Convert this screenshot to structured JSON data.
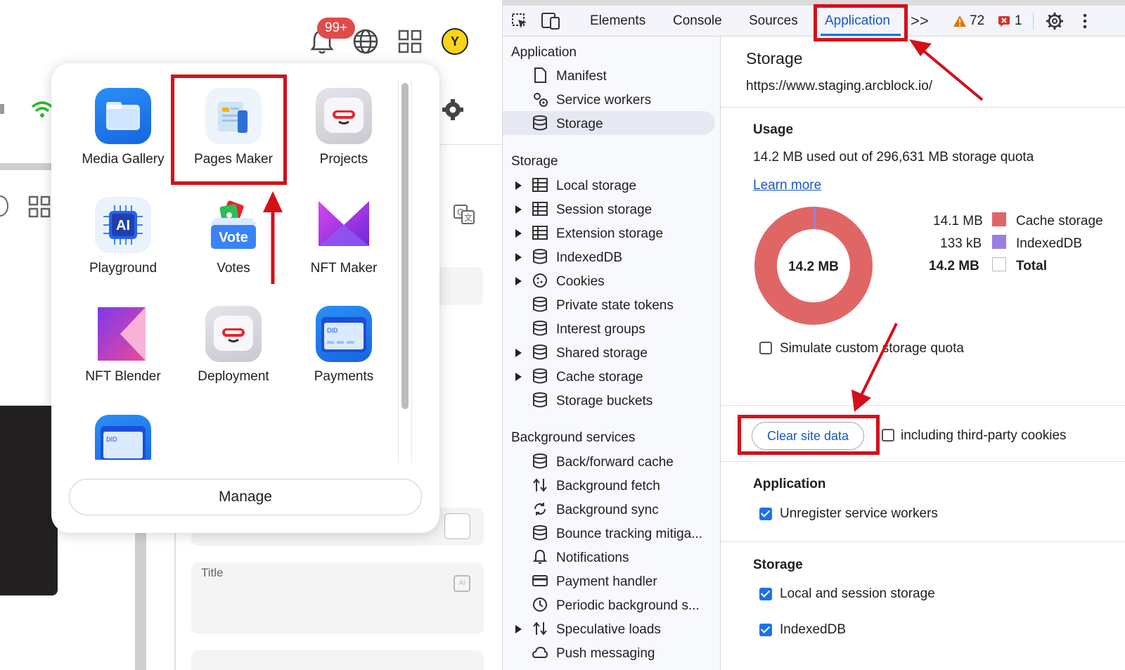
{
  "left_app": {
    "notification_badge": "99+",
    "avatar_letter": "Y",
    "apps": [
      {
        "label": "Media Gallery"
      },
      {
        "label": "Pages Maker"
      },
      {
        "label": "Projects"
      },
      {
        "label": "Playground"
      },
      {
        "label": "Votes"
      },
      {
        "label": "NFT Maker"
      },
      {
        "label": "NFT Blender"
      },
      {
        "label": "Deployment"
      },
      {
        "label": "Payments"
      }
    ],
    "vote_icon_text": "Vote",
    "ai_icon_text": "AI",
    "did_icon_text": "DID",
    "manage_label": "Manage",
    "title_field_label": "Title"
  },
  "devtools": {
    "tabs": [
      "Elements",
      "Console",
      "Sources",
      "Application"
    ],
    "active_tab": "Application",
    "more_tabs": ">>",
    "warnings_count": "72",
    "errors_count": "1",
    "sidebar": {
      "application_header": "Application",
      "application_items": [
        "Manifest",
        "Service workers",
        "Storage"
      ],
      "storage_header": "Storage",
      "storage_items": [
        "Local storage",
        "Session storage",
        "Extension storage",
        "IndexedDB",
        "Cookies",
        "Private state tokens",
        "Interest groups",
        "Shared storage",
        "Cache storage",
        "Storage buckets"
      ],
      "background_header": "Background services",
      "background_items": [
        "Back/forward cache",
        "Background fetch",
        "Background sync",
        "Bounce tracking mitiga...",
        "Notifications",
        "Payment handler",
        "Periodic background s...",
        "Speculative loads",
        "Push messaging"
      ]
    },
    "main": {
      "title": "Storage",
      "origin": "https://www.staging.arcblock.io/",
      "usage_header": "Usage",
      "usage_text": "14.2 MB used out of 296,631 MB storage quota",
      "learn_more": "Learn more",
      "donut_center": "14.2 MB",
      "legend": [
        {
          "value": "14.1 MB",
          "label": "Cache storage",
          "color": "#e06666"
        },
        {
          "value": "133 kB",
          "label": "IndexedDB",
          "color": "#9b7ee0"
        },
        {
          "value": "14.2 MB",
          "label": "Total",
          "color": "#ffffff"
        }
      ],
      "simulate_label": "Simulate custom storage quota",
      "clear_button": "Clear site data",
      "third_party_label": "including third-party cookies",
      "application_header": "Application",
      "unregister_label": "Unregister service workers",
      "storage_header": "Storage",
      "local_session_label": "Local and session storage",
      "indexeddb_label": "IndexedDB"
    }
  },
  "colors": {
    "annotation_red": "#d3101a",
    "accent_blue": "#1a73e8",
    "cache_red": "#e06666",
    "indexeddb_purple": "#9b7ee0"
  }
}
